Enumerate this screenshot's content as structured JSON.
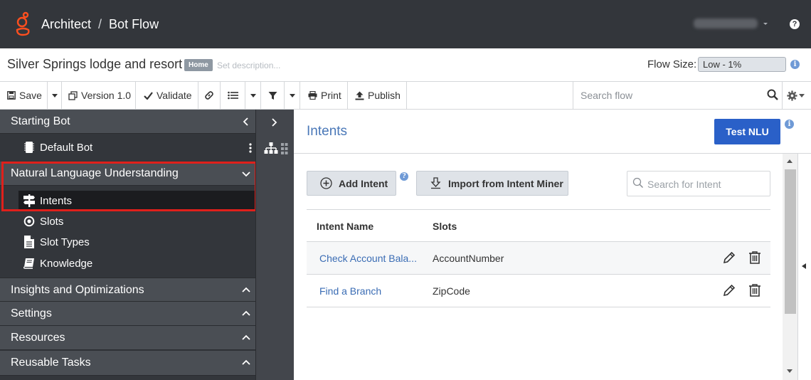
{
  "header": {
    "breadcrumb": [
      "Architect",
      "Bot Flow"
    ],
    "breadcrumb_separator": "/",
    "help_glyph": "?"
  },
  "flow": {
    "title": "Silver Springs lodge and resort",
    "badge": "Home",
    "description_placeholder": "Set description...",
    "size_label": "Flow Size:",
    "size_value": "Low - 1%"
  },
  "toolbar": {
    "save": "Save",
    "version": "Version 1.0",
    "validate": "Validate",
    "print": "Print",
    "publish": "Publish",
    "search_placeholder": "Search flow"
  },
  "sidebar": {
    "sections": [
      {
        "label": "Starting Bot"
      },
      {
        "label": "Natural Language Understanding"
      },
      {
        "label": "Insights and Optimizations"
      },
      {
        "label": "Settings"
      },
      {
        "label": "Resources"
      },
      {
        "label": "Reusable Tasks"
      }
    ],
    "starting_bot_items": [
      {
        "label": "Default Bot",
        "icon": "bot-chip-icon"
      }
    ],
    "nlu_items": [
      {
        "label": "Intents",
        "icon": "signpost-icon",
        "selected": true
      },
      {
        "label": "Slots",
        "icon": "target-icon"
      },
      {
        "label": "Slot Types",
        "icon": "document-icon"
      },
      {
        "label": "Knowledge",
        "icon": "book-icon"
      }
    ]
  },
  "intents_panel": {
    "title": "Intents",
    "test_nlu": "Test NLU",
    "add_intent": "Add Intent",
    "import_intent": "Import from Intent Miner",
    "search_placeholder": "Search for Intent",
    "columns": [
      "Intent Name",
      "Slots"
    ],
    "rows": [
      {
        "name": "Check Account Bala...",
        "slots": "AccountNumber"
      },
      {
        "name": "Find a Branch",
        "slots": "ZipCode"
      }
    ]
  },
  "colors": {
    "topbar": "#33363b",
    "accent_blue": "#2a60c8",
    "link_blue": "#3a6cb4",
    "highlight_red": "#e0201b"
  }
}
